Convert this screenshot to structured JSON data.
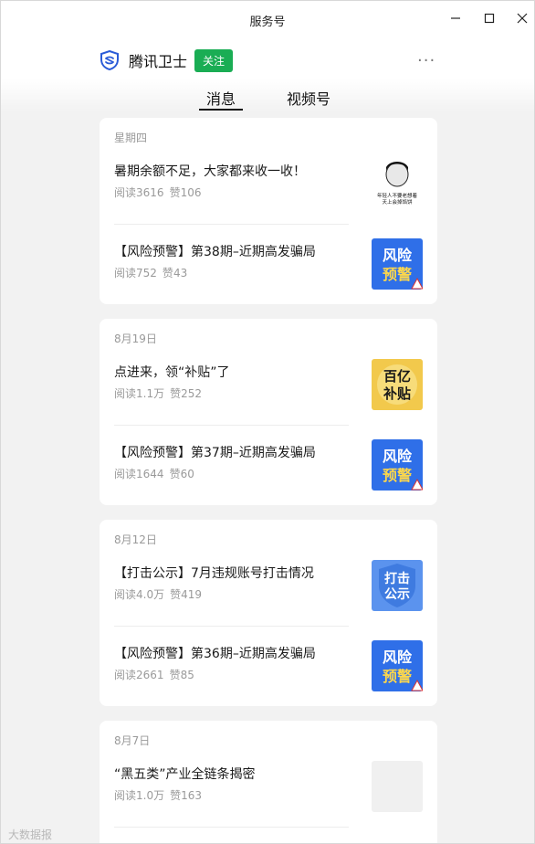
{
  "window": {
    "title": "服务号"
  },
  "account": {
    "name": "腾讯卫士",
    "follow_label": "关注",
    "more_label": "···"
  },
  "tabs": [
    {
      "label": "消息",
      "active": true
    },
    {
      "label": "视频号",
      "active": false
    }
  ],
  "stats_labels": {
    "read": "阅读",
    "like": "赞"
  },
  "groups": [
    {
      "date": "星期四",
      "items": [
        {
          "title": "暑期余额不足，大家都来收一收！",
          "read": "3616",
          "like": "106",
          "thumb": "meme"
        },
        {
          "title": "【风险预警】第38期–近期高发骗局",
          "read": "752",
          "like": "43",
          "thumb": "risk"
        }
      ]
    },
    {
      "date": "8月19日",
      "items": [
        {
          "title": "点进来，领“补贴”了",
          "read": "1.1万",
          "like": "252",
          "thumb": "subsidy"
        },
        {
          "title": "【风险预警】第37期–近期高发骗局",
          "read": "1644",
          "like": "60",
          "thumb": "risk"
        }
      ]
    },
    {
      "date": "8月12日",
      "items": [
        {
          "title": "【打击公示】7月违规账号打击情况",
          "read": "4.0万",
          "like": "419",
          "thumb": "crackdown"
        },
        {
          "title": "【风险预警】第36期–近期高发骗局",
          "read": "2661",
          "like": "85",
          "thumb": "risk"
        }
      ]
    },
    {
      "date": "8月7日",
      "items": [
        {
          "title": "“黑五类”产业全链条揭密",
          "read": "1.0万",
          "like": "163",
          "thumb": "blank"
        }
      ]
    }
  ],
  "thumb_texts": {
    "meme": [
      "年轻人不要老想着",
      "天上会掉馅饼"
    ],
    "risk": [
      "风险",
      "预警"
    ],
    "subsidy": [
      "百亿",
      "补贴"
    ],
    "crackdown": [
      "打击",
      "公示"
    ]
  },
  "watermark": "大数据报",
  "colors": {
    "accent_green": "#1aad54",
    "risk_blue": "#2f6fe8",
    "subsidy_gold": "#f2c94c"
  }
}
